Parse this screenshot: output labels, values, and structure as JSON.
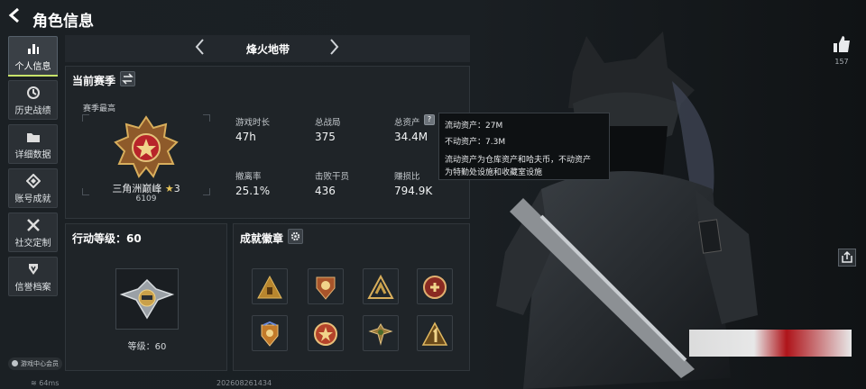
{
  "header": {
    "back_icon": "back-arrow-icon",
    "title": "角色信息"
  },
  "sidebar": {
    "items": [
      {
        "label": "个人信息",
        "icon": "bar-chart-icon",
        "active": true
      },
      {
        "label": "历史战绩",
        "icon": "history-icon"
      },
      {
        "label": "详细数据",
        "icon": "folder-icon"
      },
      {
        "label": "账号成就",
        "icon": "achievement-icon"
      },
      {
        "label": "社交定制",
        "icon": "tools-icon"
      },
      {
        "label": "信誉档案",
        "icon": "shield-icon"
      }
    ],
    "footer": "游戏中心会员"
  },
  "mode": {
    "label": "烽火地带"
  },
  "season": {
    "title": "当前赛季",
    "best_label": "赛季最高",
    "rank_name": "三角洲巅峰",
    "rank_stars": "3",
    "rank_score": "6109",
    "stats": [
      {
        "label": "游戏时长",
        "value": "47h"
      },
      {
        "label": "总战局",
        "value": "375"
      },
      {
        "label": "总资产",
        "value": "34.4M"
      },
      {
        "label": "撤离率",
        "value": "25.1%"
      },
      {
        "label": "击败干员",
        "value": "436"
      },
      {
        "label": "赚损比",
        "value": "794.9K"
      }
    ]
  },
  "tooltip": {
    "liquid": "流动资产：27M",
    "fixed": "不动资产：7.3M",
    "desc1": "流动资产为仓库资产和哈夫币，不动资产",
    "desc2": "为特勤处设施和收藏室设施"
  },
  "action_level": {
    "title": "行动等级：60",
    "level_text": "等级：60"
  },
  "achievements": {
    "title": "成就徽章",
    "count": 8
  },
  "right": {
    "like_count": "157"
  },
  "footer": {
    "ping": "64ms",
    "uid": "202608261434"
  },
  "colors": {
    "accent": "#c8e36a",
    "panel": "#1f2428",
    "gold": "#c9a04a"
  }
}
